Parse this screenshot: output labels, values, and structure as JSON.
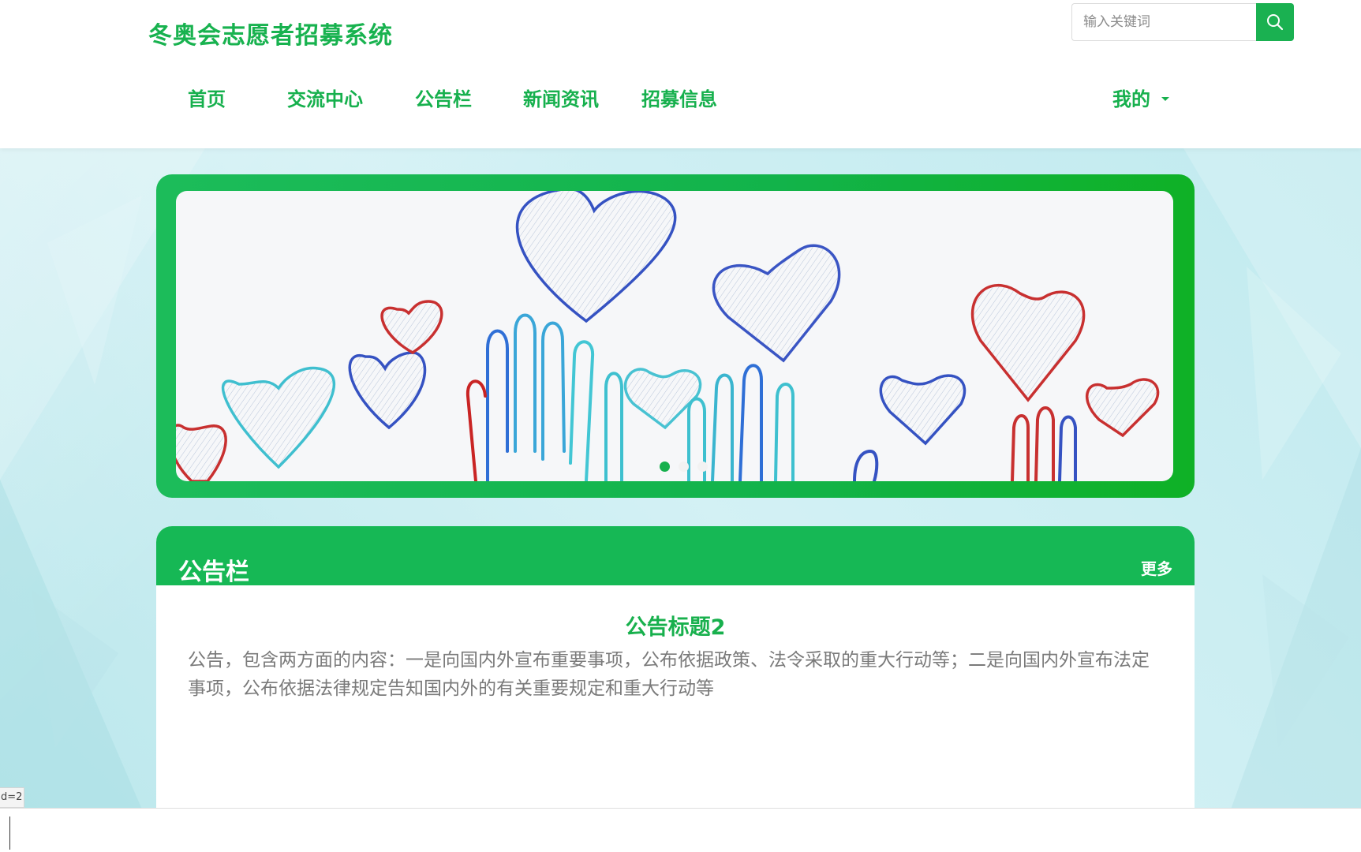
{
  "header": {
    "site_title": "冬奥会志愿者招募系统",
    "search": {
      "placeholder": "输入关键词",
      "icon": "search-icon"
    },
    "nav": [
      {
        "label": "首页"
      },
      {
        "label": "交流中心"
      },
      {
        "label": "公告栏"
      },
      {
        "label": "新闻资讯"
      },
      {
        "label": "招募信息"
      }
    ],
    "mine_label": "我的"
  },
  "banner": {
    "slide_count": 3,
    "active_slide": 1,
    "image": "hearts-and-hands-illustration"
  },
  "notice_board": {
    "title": "公告栏",
    "more_label": "更多",
    "item": {
      "title": "公告标题2",
      "body": "公告，包含两方面的内容：一是向国内外宣布重要事项，公布依据政策、法令采取的重大行动等；二是向国内外宣布法定事项，公布依据法律规定告知国内外的有关重要规定和重大行动等"
    }
  },
  "status_tag": "d=2",
  "colors": {
    "brand_green": "#16b04d",
    "banner_frame": "#12b34a",
    "background": "#cdeef2",
    "body_text": "#7a7a7a"
  }
}
